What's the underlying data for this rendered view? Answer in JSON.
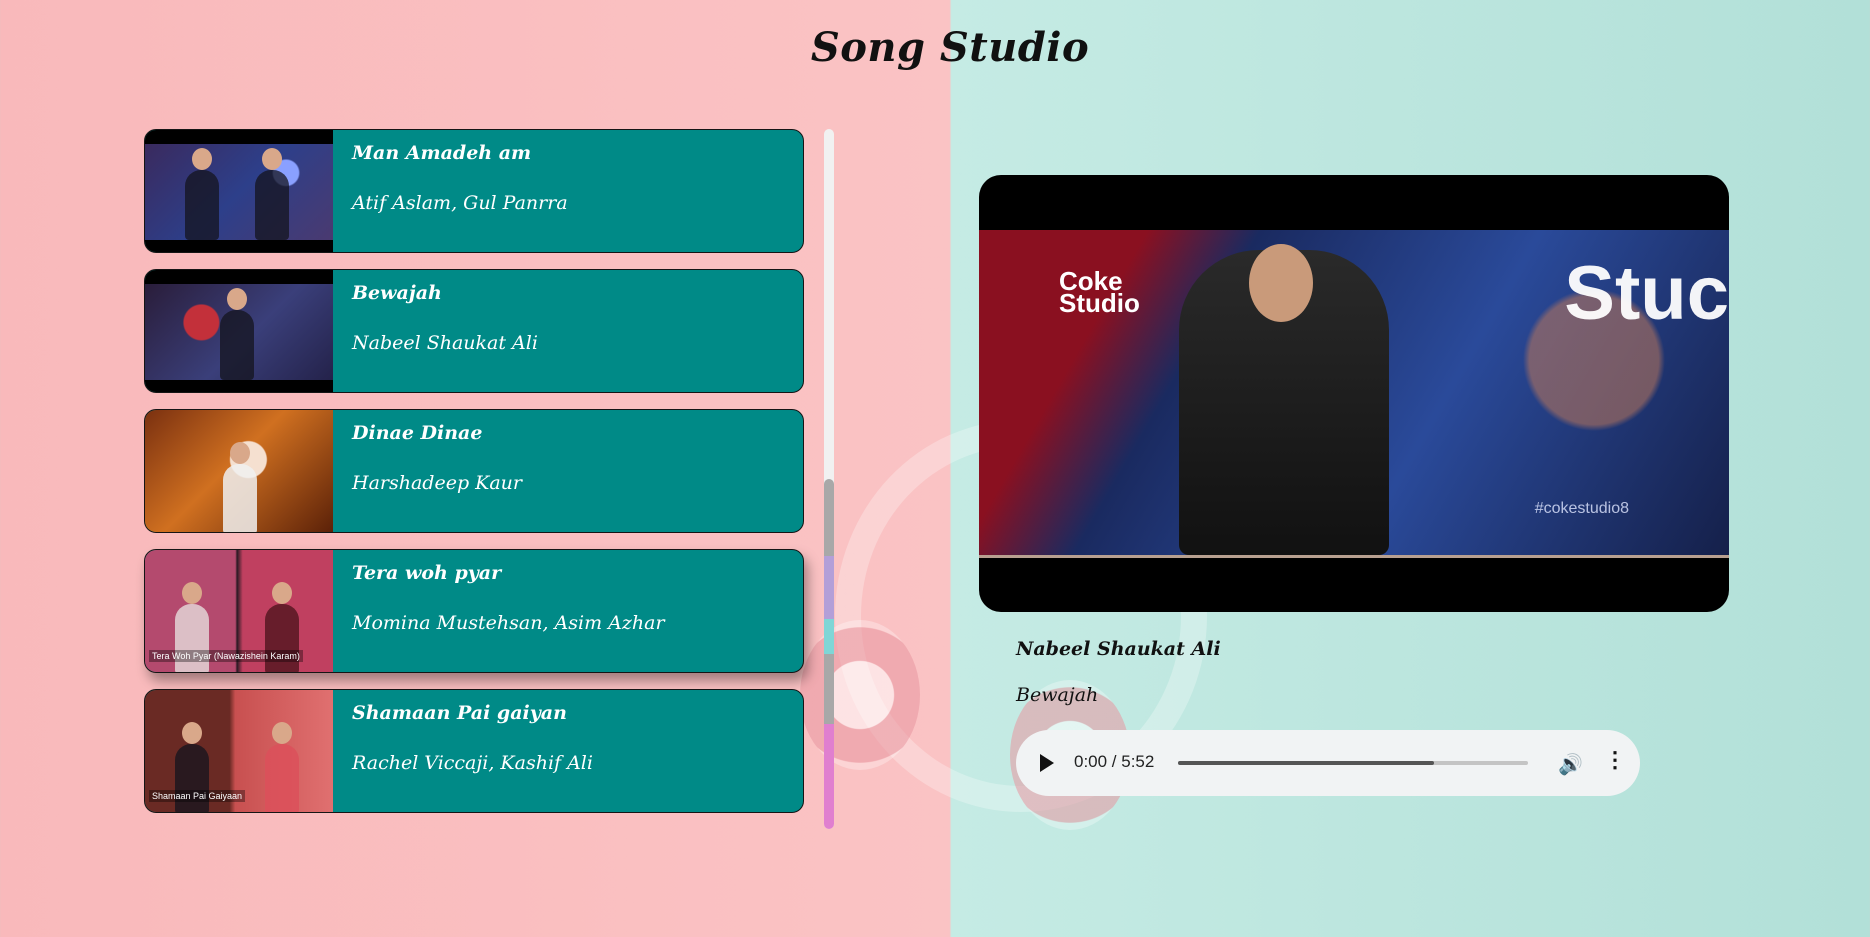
{
  "app": {
    "title": "Song Studio"
  },
  "playlist": [
    {
      "title": "Man Amadeh am",
      "artist": "Atif Aslam, Gul Panrra",
      "thumb_caption": ""
    },
    {
      "title": "Bewajah",
      "artist": "Nabeel Shaukat Ali",
      "thumb_caption": ""
    },
    {
      "title": "Dinae Dinae",
      "artist": "Harshadeep Kaur",
      "thumb_caption": ""
    },
    {
      "title": "Tera woh pyar",
      "artist": "Momina Mustehsan, Asim Azhar",
      "thumb_caption": "Tera Woh Pyar (Nawazishein Karam)"
    },
    {
      "title": "Shamaan Pai gaiyan",
      "artist": "Rachel Viccaji, Kashif Ali",
      "thumb_caption": "Shamaan Pai Gaiyaan"
    }
  ],
  "now_playing": {
    "artist": "Nabeel Shaukat Ali",
    "title": "Bewajah",
    "video_logo_line1": "Coke",
    "video_logo_line2": "Studio",
    "video_brand": "Stuc",
    "video_tag": "#cokestudio8"
  },
  "player": {
    "time": "0:00 / 5:52",
    "progress_fraction": 0.73,
    "volume_icon": "volume-icon",
    "more_icon": "more-options-icon"
  },
  "scrollbar": {
    "thumb_fraction": 0.5
  }
}
